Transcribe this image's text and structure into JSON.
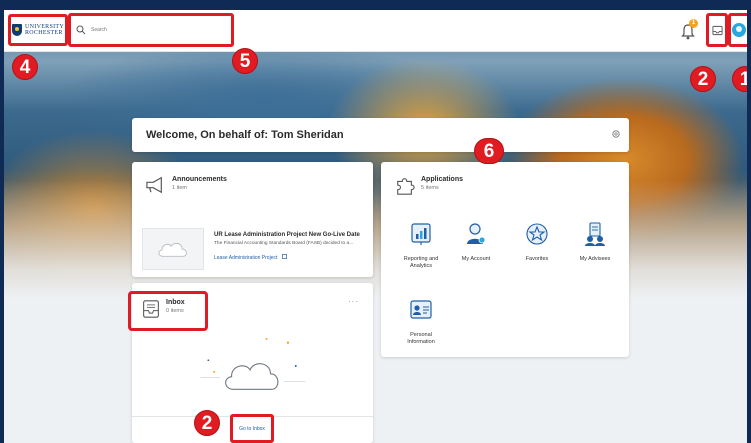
{
  "topbar": {
    "logo_line1": "UNIVERSITY",
    "logo_line2": "ROCHESTER",
    "search_placeholder": "Search",
    "notification_count": "1"
  },
  "callouts": {
    "one": "1",
    "two_top": "2",
    "two_bottom": "2",
    "four": "4",
    "five": "5",
    "six": "6"
  },
  "welcome": {
    "title": "Welcome, On behalf of: Tom Sheridan"
  },
  "announcements": {
    "title": "Announcements",
    "count": "1 item",
    "item_title": "UR Lease Administration Project New Go-Live Date",
    "item_desc": "The Financial Accounting Standards Board (FASB) decided to a...",
    "item_link": "Lease Administration Project"
  },
  "inbox": {
    "title": "Inbox",
    "count": "0 items",
    "more": "···",
    "goto_label": "Go to Inbox"
  },
  "applications": {
    "title": "Applications",
    "count": "5 items",
    "items": [
      {
        "label_1": "Reporting and",
        "label_2": "Analytics"
      },
      {
        "label_1": "My Account",
        "label_2": ""
      },
      {
        "label_1": "Favorites",
        "label_2": ""
      },
      {
        "label_1": "My Advisees",
        "label_2": ""
      },
      {
        "label_1": "Personal",
        "label_2": "Information"
      }
    ]
  },
  "colors": {
    "callout_red": "#e11b22",
    "link_blue": "#1f5fa8",
    "icon_blue": "#1f5fa8",
    "profile_blue": "#29a8e0",
    "badge_orange": "#f7a21b"
  }
}
